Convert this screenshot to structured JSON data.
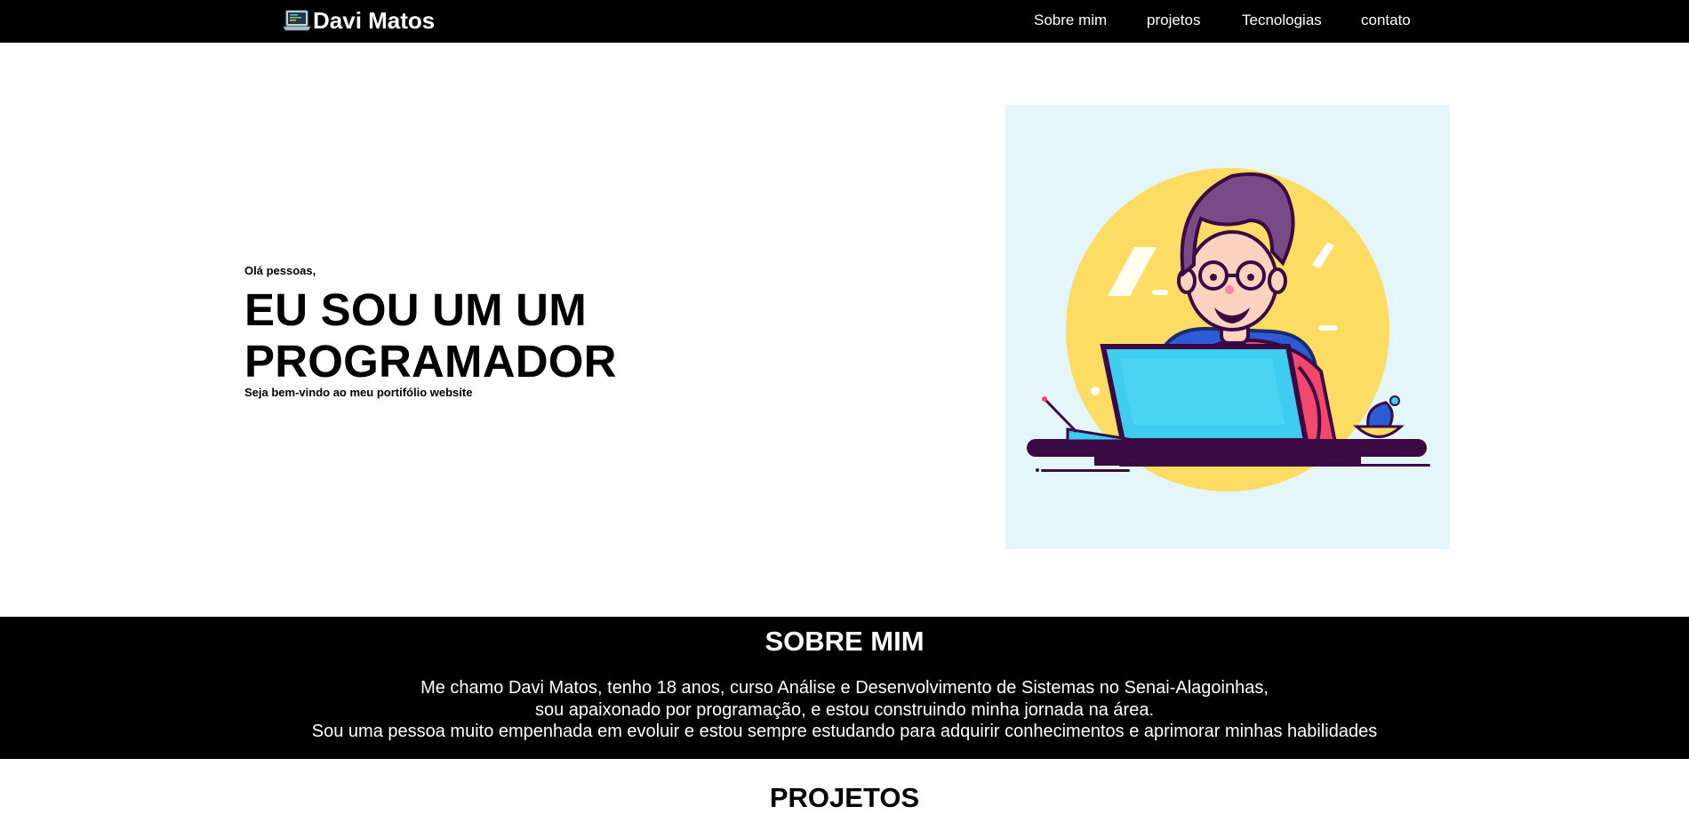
{
  "header": {
    "brand_name": "Davi Matos",
    "brand_icon": "laptop-icon",
    "nav": [
      {
        "label": "Sobre mim"
      },
      {
        "label": "projetos"
      },
      {
        "label": "Tecnologias"
      },
      {
        "label": "contato"
      }
    ]
  },
  "hero": {
    "greeting": "Olá pessoas,",
    "title_line1": "EU SOU UM UM",
    "title_line2": "PROGRAMADOR",
    "subtitle": "Seja bem-vindo ao meu portifólio website",
    "illustration": "programmer-at-laptop-illustration"
  },
  "about": {
    "title": "SOBRE MIM",
    "lines": [
      "Me chamo Davi Matos, tenho 18 anos, curso Análise e Desenvolvimento de Sistemas no Senai-Alagoinhas,",
      "sou apaixonado por programação, e estou construindo minha jornada na área.",
      "Sou uma pessoa muito empenhada em evoluir e estou sempre estudando para adquirir conhecimentos e aprimorar minhas habilidades"
    ]
  },
  "projects": {
    "title": "PROJETOS"
  },
  "colors": {
    "header_bg": "#000000",
    "about_bg": "#000000",
    "illustration_bg": "#e4f6fa",
    "sun": "#fddc63",
    "laptop": "#3ecdf0",
    "shirt": "#f2486e",
    "hair": "#7a4a86",
    "desk": "#3b0a45"
  }
}
